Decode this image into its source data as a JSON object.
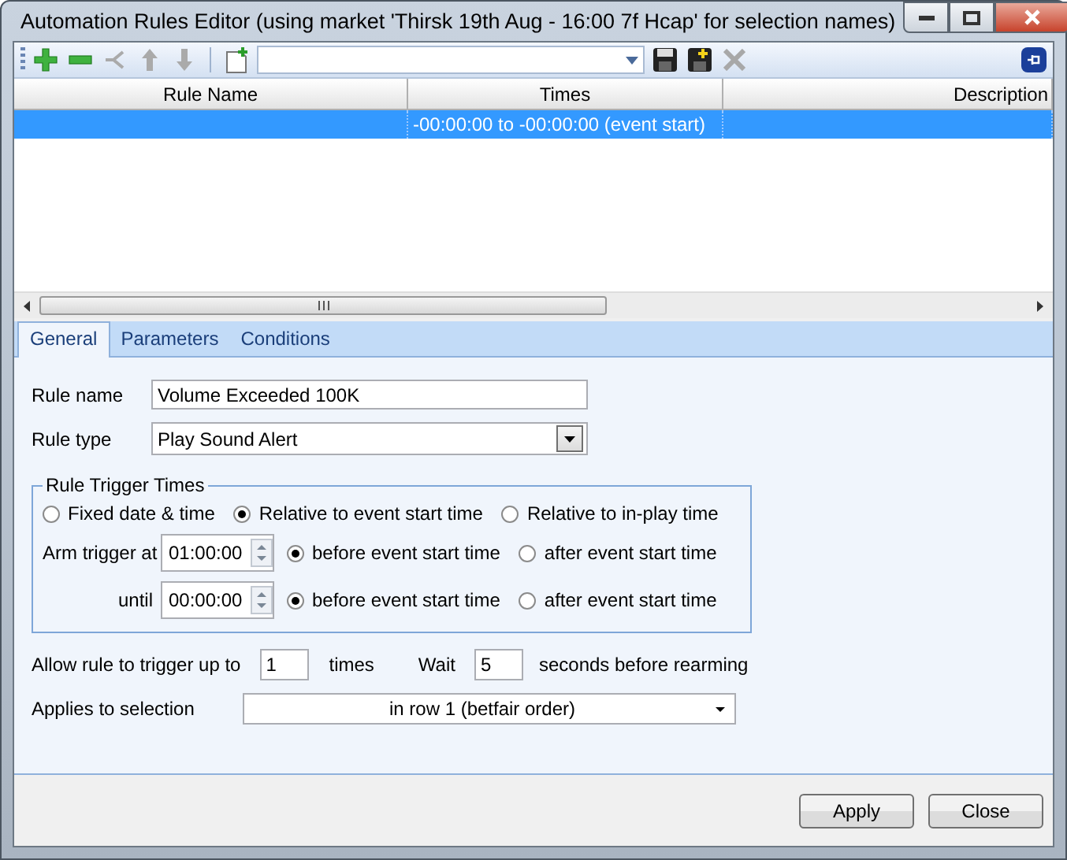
{
  "window": {
    "title": "Automation Rules Editor (using market 'Thirsk 19th Aug - 16:00 7f Hcap' for selection names)"
  },
  "toolbar": {
    "items": [
      {
        "kind": "add",
        "disabled": false
      },
      {
        "kind": "remove",
        "disabled": false
      },
      {
        "kind": "branch",
        "disabled": true
      },
      {
        "kind": "up",
        "disabled": true
      },
      {
        "kind": "down",
        "disabled": true
      },
      {
        "kind": "separator"
      },
      {
        "kind": "new",
        "disabled": false
      },
      {
        "kind": "combo"
      },
      {
        "kind": "save",
        "disabled": false
      },
      {
        "kind": "save-new",
        "disabled": false
      },
      {
        "kind": "delete",
        "disabled": true
      }
    ]
  },
  "table": {
    "columns": [
      "Rule Name",
      "Times",
      "Description"
    ],
    "rows": [
      {
        "times": "-00:00:00 to -00:00:00 (event start)",
        "selected": true
      }
    ]
  },
  "tabs": [
    {
      "label": "General",
      "selected": true
    },
    {
      "label": "Parameters",
      "selected": false
    },
    {
      "label": "Conditions",
      "selected": false
    }
  ],
  "form": {
    "rule_name": {
      "label": "Rule name",
      "value": "Volume Exceeded 100K"
    },
    "rule_type": {
      "label": "Rule type",
      "value": "Play Sound Alert"
    },
    "trigger_times": {
      "title": "Rule Trigger Times",
      "modes": [
        {
          "label": "Fixed date & time",
          "selected": false
        },
        {
          "label": "Relative to event start time",
          "selected": true
        },
        {
          "label": "Relative to in-play time",
          "selected": false
        }
      ],
      "arm": {
        "label": "Arm trigger at",
        "value": "01:00:00",
        "options": [
          {
            "label": "before event start time",
            "selected": true
          },
          {
            "label": "after event start time",
            "selected": false
          }
        ]
      },
      "until": {
        "label": "until",
        "value": "00:00:00",
        "options": [
          {
            "label": "before event start time",
            "selected": true
          },
          {
            "label": "after event start time",
            "selected": false
          }
        ]
      }
    },
    "repeat": {
      "label": "Allow rule to trigger up to",
      "value": "1",
      "unit": "times"
    },
    "wait": {
      "label": "Wait",
      "value": "5",
      "unit": "seconds before rearming"
    },
    "applies": {
      "label": "Applies to selection",
      "value": "in row 1 (betfair order)"
    }
  },
  "buttons": [
    "Apply",
    "Close"
  ]
}
